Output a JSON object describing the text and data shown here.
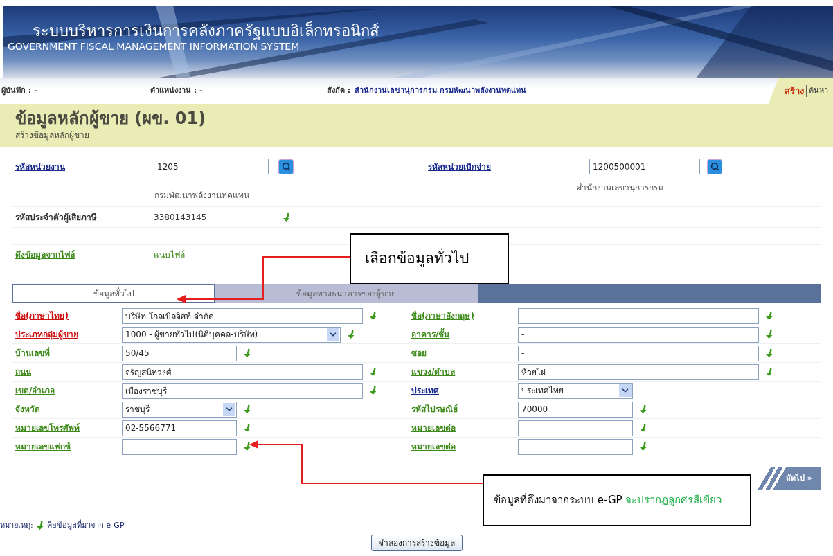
{
  "header": {
    "title_thai": "ระบบบริหารการเงินการคลังภาครัฐแบบอิเล็กทรอนิกส์",
    "title_english": "GOVERNMENT FISCAL MANAGEMENT INFORMATION SYSTEM"
  },
  "info_bar": {
    "recorder": "ผู้บันทึก : -",
    "position": "ตำแหน่งงาน : -",
    "affiliation_label": "สังกัด :",
    "affiliation": "สำนักงานเลขานุการกรม กรมพัฒนาพลังงานทดแทน"
  },
  "menu": [
    {
      "label": "สร้าง",
      "selected": true
    },
    {
      "label": "ค้นหา",
      "selected": false
    }
  ],
  "page": {
    "title": "ข้อมูลหลักผู้ขาย (ผข. 01)",
    "subtitle": "สร้างข้อมูลหลักผู้ขาย"
  },
  "unit": {
    "label": "รหัสหน่วยงาน",
    "value": "1205",
    "name": "กรมพัฒนาพลังงานทดแทน"
  },
  "disbursing_unit": {
    "label": "รหัสหน่วยเบิกจ่าย",
    "value": "1200500001",
    "name": "สำนักงานเลขานุการกรม"
  },
  "tax_id": {
    "label": "รหัสประจำตัวผู้เสียภาษี",
    "value": "3380143145",
    "egp": true
  },
  "file_import": {
    "label": "ดึงข้อมูลจากไฟล์",
    "link": "แนบไฟล์"
  },
  "tabs": [
    {
      "label": "ข้อมูลทั่วไป",
      "selected": true
    },
    {
      "label": "ข้อมูลทางธนาคารของผู้ขาย",
      "selected": false
    }
  ],
  "left_fields": [
    {
      "label": "ชื่อ(ภาษาไทย)",
      "color": "#cc1111",
      "kind": "text_long",
      "value": "บริษัท โกลเบิลจิสท์ จำกัด",
      "egp": true
    },
    {
      "label": "ประเภทกลุ่มผู้ขาย",
      "color": "#cc1111",
      "kind": "select_long",
      "value": "1000 - ผู้ขายทั่วไป(นิติบุคคล-บริษัท)",
      "egp": true
    },
    {
      "label": "บ้านเลขที่",
      "color": "#3d8a1a",
      "kind": "text_short",
      "value": "50/45",
      "egp": true
    },
    {
      "label": "ถนน",
      "color": "#3d8a1a",
      "kind": "text_long",
      "value": "จรัญสนิทวงศ์",
      "egp": true
    },
    {
      "label": "เขต/อำเภอ",
      "color": "#3d8a1a",
      "kind": "text_long",
      "value": "เมืองราชบุรี",
      "egp": true
    },
    {
      "label": "จังหวัด",
      "color": "#3d8a1a",
      "kind": "select_short",
      "value": "ราชบุรี",
      "egp": true
    },
    {
      "label": "หมายเลขโทรศัพท์",
      "color": "#3d8a1a",
      "kind": "text_short",
      "value": "02-5566771",
      "egp": true
    },
    {
      "label": "หมายเลขแฟกซ์",
      "color": "#3d8a1a",
      "kind": "text_short",
      "egp": true
    }
  ],
  "right_fields": [
    {
      "label": "ชื่อ(ภาษาอังกฤษ)",
      "color": "#3d8a1a",
      "kind": "text_long",
      "egp": true
    },
    {
      "label": "อาคาร/ชั้น",
      "color": "#3d8a1a",
      "kind": "text_long",
      "value": "-",
      "egp": true
    },
    {
      "label": "ซอย",
      "color": "#3d8a1a",
      "kind": "text_long",
      "value": "-",
      "egp": true
    },
    {
      "label": "แขวง/ตำบล",
      "color": "#3d8a1a",
      "kind": "text_long",
      "value": "ห้วยไผ่",
      "egp": true
    },
    {
      "label": "ประเทศ",
      "color": "#1a2a8c",
      "kind": "select_short",
      "value": "ประเทศไทย",
      "egp": false
    },
    {
      "label": "รหัสไปรษณีย์",
      "color": "#3d8a1a",
      "kind": "text_short",
      "value": "70000",
      "egp": true
    },
    {
      "label": "หมายเลขต่อ",
      "color": "#3d8a1a",
      "kind": "text_short",
      "egp": true
    },
    {
      "label": "หมายเลขต่อ",
      "color": "#3d8a1a",
      "kind": "text_short",
      "egp": true
    }
  ],
  "next_button": "ถัดไป »",
  "note": {
    "label": "หมายเหตุ:",
    "text": "คือข้อมูลที่มาจาก e-GP"
  },
  "simulate_button": "จำลองการสร้างข้อมูล",
  "callouts": [
    {
      "text": "เลือกข้อมูลทั่วไป"
    },
    {
      "text": "ข้อมูลที่ดึงมาจากระบบ e-GP",
      "highlight": "จะปรากฏลูกศรสีเขียว"
    }
  ]
}
